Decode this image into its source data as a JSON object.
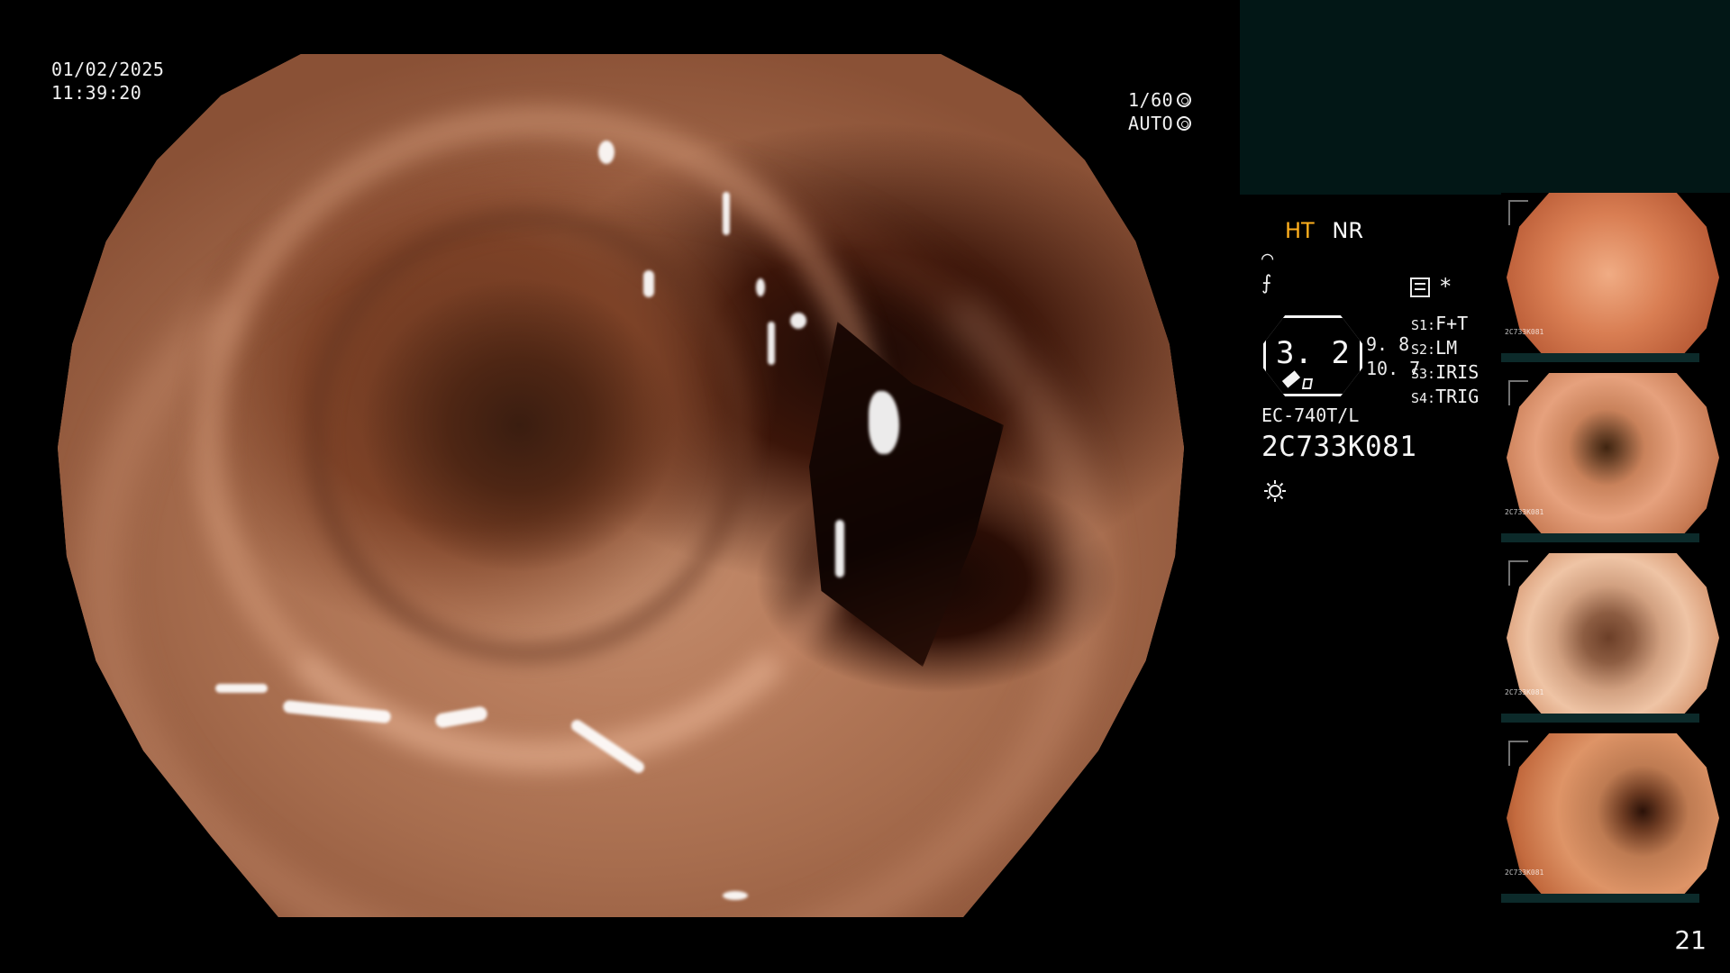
{
  "main": {
    "date": "01/02/2025",
    "time": "11:39:20",
    "shutter": "1/60",
    "exposure_mode": "AUTO"
  },
  "panel": {
    "mode_ht": "HT",
    "mode_nr": "NR",
    "glyph_1": "⌒",
    "glyph_2": "⨍",
    "asterisk": "*",
    "octagon_value": "3. 2",
    "value_1": "9. 8",
    "value_2": "10. 7",
    "settings": [
      {
        "key": "S1:",
        "value": "F+T"
      },
      {
        "key": "S2:",
        "value": "LM"
      },
      {
        "key": "S3:",
        "value": "IRIS"
      },
      {
        "key": "S4:",
        "value": "TRIG"
      }
    ],
    "model": "EC-740T/L",
    "serial": "2C733K081",
    "icons": {
      "record": "record-icon",
      "brightness": "brightness-icon",
      "pen": "pen-icon",
      "box": "box-icon"
    }
  },
  "thumbnails": [
    {
      "label": "2C733K081"
    },
    {
      "label": "2C733K081"
    },
    {
      "label": "2C733K081"
    },
    {
      "label": "2C733K081"
    }
  ],
  "footer": {
    "slide_number": "21"
  },
  "colors": {
    "ht_accent": "#ffb01e",
    "teal_box": "#021716"
  }
}
